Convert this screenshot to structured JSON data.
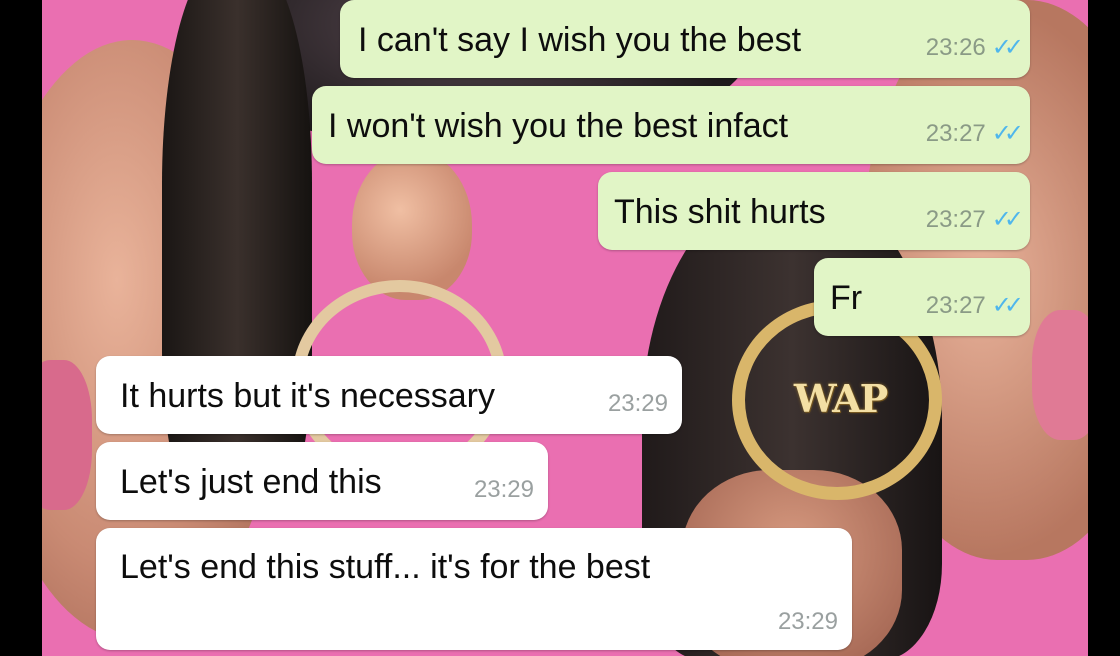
{
  "wallpaper": {
    "hoop_text": "WAP"
  },
  "messages": [
    {
      "direction": "outgoing",
      "text": "I can't say I wish you the best",
      "time": "23:26",
      "status": "read",
      "status_icon": "double-check-icon"
    },
    {
      "direction": "outgoing",
      "text": "I won't wish you the best infact",
      "time": "23:27",
      "status": "read",
      "status_icon": "double-check-icon"
    },
    {
      "direction": "outgoing",
      "text": "This shit hurts",
      "time": "23:27",
      "status": "read",
      "status_icon": "double-check-icon"
    },
    {
      "direction": "outgoing",
      "text": "Fr",
      "time": "23:27",
      "status": "read",
      "status_icon": "double-check-icon"
    },
    {
      "direction": "incoming",
      "text": "It hurts but it's necessary",
      "time": "23:29"
    },
    {
      "direction": "incoming",
      "text": "Let's just end this",
      "time": "23:29"
    },
    {
      "direction": "incoming",
      "text": "Let's end this stuff... it's for the best",
      "time": "23:29"
    }
  ],
  "colors": {
    "outgoing_bubble": "#e1f5c6",
    "incoming_bubble": "#ffffff",
    "read_ticks": "#4fb6ec",
    "wallpaper_pink": "#ea6fb1"
  }
}
